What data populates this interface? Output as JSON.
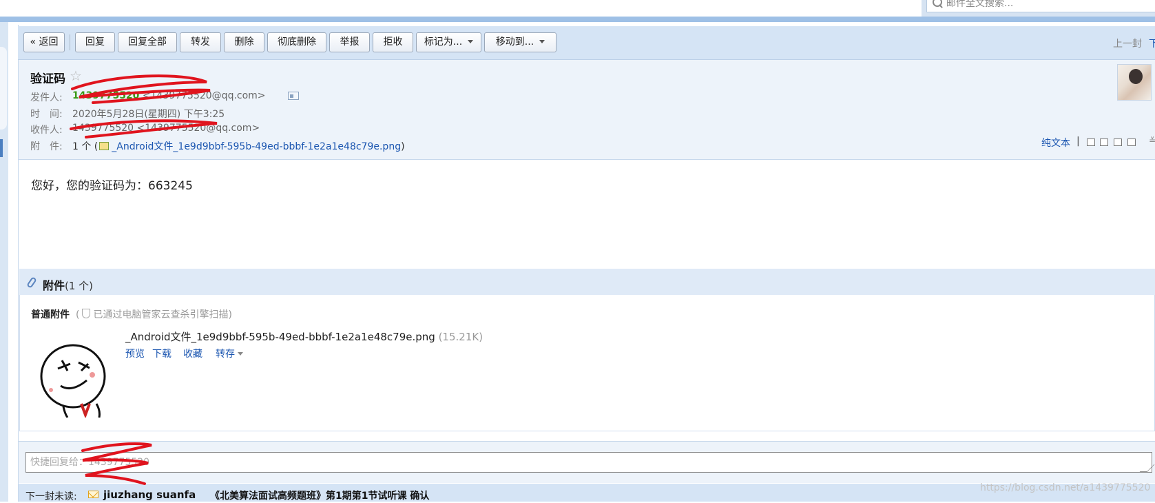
{
  "search": {
    "placeholder": "邮件全文搜索..."
  },
  "toolbar": {
    "back": "« 返回",
    "reply": "回复",
    "reply_all": "回复全部",
    "forward": "转发",
    "delete": "删除",
    "delete_permanently": "彻底删除",
    "report": "举报",
    "reject": "拒收",
    "mark_as": "标记为...",
    "move_to": "移动到...",
    "prev_mail": "上一封",
    "next_mail": "下一封"
  },
  "header": {
    "subject": "验证码",
    "from_label": "发件人:",
    "from_name": "1439775520",
    "from_email": "<1439775520@qq.com>",
    "time_label": "时　间:",
    "time_value": "2020年5月28日(星期四) 下午3:25",
    "to_label": "收件人:",
    "to_value": "1439775520 <1439775520@qq.com>",
    "attach_label": "附　件:",
    "attach_count": "1 个 (",
    "attach_name": "_Android文件_1e9d9bbf-595b-49ed-bbbf-1e2a1e48c79e.png",
    "attach_close": ")",
    "plain_text": "纯文本",
    "sep": "|"
  },
  "body": {
    "text": "您好，您的验证码为：663245"
  },
  "attachments": {
    "title": "附件",
    "count": "(1 个)",
    "normal_label": "普通附件",
    "scan_note_open": "(",
    "scan_note": "已通过电脑管家云查杀引擎扫描)",
    "file_name": "_Android文件_1e9d9bbf-595b-49ed-bbbf-1e2a1e48c79e.png",
    "file_size": "(15.21K)",
    "actions": {
      "preview": "预览",
      "download": "下载",
      "favorite": "收藏",
      "save_to": "转存"
    }
  },
  "quick_reply": {
    "placeholder": "快捷回复给：1439775520"
  },
  "next_unread": {
    "label": "下一封未读:",
    "sender": "jiuzhang suanfa",
    "subject": "《北美算法面试高频题班》第1期第1节试听课 确认"
  },
  "watermark": "https://blog.csdn.net/a1439775520",
  "colors": {
    "toolbar_bg": "#d5e4f5",
    "link": "#1a55b0",
    "sender_green": "#3a9a16",
    "redaction": "#e0141e"
  }
}
